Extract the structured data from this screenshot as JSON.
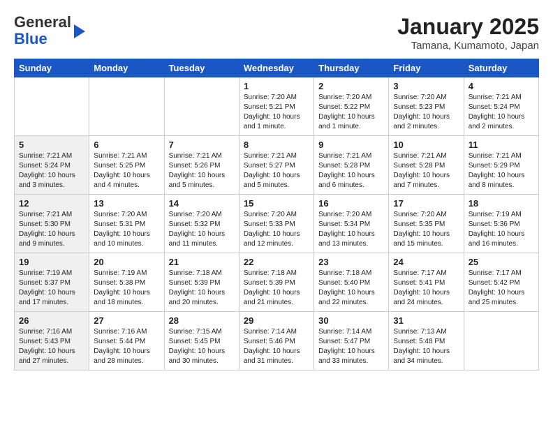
{
  "header": {
    "logo_line1": "General",
    "logo_line2": "Blue",
    "month": "January 2025",
    "location": "Tamana, Kumamoto, Japan"
  },
  "weekdays": [
    "Sunday",
    "Monday",
    "Tuesday",
    "Wednesday",
    "Thursday",
    "Friday",
    "Saturday"
  ],
  "weeks": [
    [
      {
        "day": "",
        "info": "",
        "shaded": true
      },
      {
        "day": "",
        "info": "",
        "shaded": true
      },
      {
        "day": "",
        "info": "",
        "shaded": true
      },
      {
        "day": "1",
        "info": "Sunrise: 7:20 AM\nSunset: 5:21 PM\nDaylight: 10 hours\nand 1 minute.",
        "shaded": false
      },
      {
        "day": "2",
        "info": "Sunrise: 7:20 AM\nSunset: 5:22 PM\nDaylight: 10 hours\nand 1 minute.",
        "shaded": false
      },
      {
        "day": "3",
        "info": "Sunrise: 7:20 AM\nSunset: 5:23 PM\nDaylight: 10 hours\nand 2 minutes.",
        "shaded": false
      },
      {
        "day": "4",
        "info": "Sunrise: 7:21 AM\nSunset: 5:24 PM\nDaylight: 10 hours\nand 2 minutes.",
        "shaded": false
      }
    ],
    [
      {
        "day": "5",
        "info": "Sunrise: 7:21 AM\nSunset: 5:24 PM\nDaylight: 10 hours\nand 3 minutes.",
        "shaded": true
      },
      {
        "day": "6",
        "info": "Sunrise: 7:21 AM\nSunset: 5:25 PM\nDaylight: 10 hours\nand 4 minutes.",
        "shaded": false
      },
      {
        "day": "7",
        "info": "Sunrise: 7:21 AM\nSunset: 5:26 PM\nDaylight: 10 hours\nand 5 minutes.",
        "shaded": false
      },
      {
        "day": "8",
        "info": "Sunrise: 7:21 AM\nSunset: 5:27 PM\nDaylight: 10 hours\nand 5 minutes.",
        "shaded": false
      },
      {
        "day": "9",
        "info": "Sunrise: 7:21 AM\nSunset: 5:28 PM\nDaylight: 10 hours\nand 6 minutes.",
        "shaded": false
      },
      {
        "day": "10",
        "info": "Sunrise: 7:21 AM\nSunset: 5:28 PM\nDaylight: 10 hours\nand 7 minutes.",
        "shaded": false
      },
      {
        "day": "11",
        "info": "Sunrise: 7:21 AM\nSunset: 5:29 PM\nDaylight: 10 hours\nand 8 minutes.",
        "shaded": false
      }
    ],
    [
      {
        "day": "12",
        "info": "Sunrise: 7:21 AM\nSunset: 5:30 PM\nDaylight: 10 hours\nand 9 minutes.",
        "shaded": true
      },
      {
        "day": "13",
        "info": "Sunrise: 7:20 AM\nSunset: 5:31 PM\nDaylight: 10 hours\nand 10 minutes.",
        "shaded": false
      },
      {
        "day": "14",
        "info": "Sunrise: 7:20 AM\nSunset: 5:32 PM\nDaylight: 10 hours\nand 11 minutes.",
        "shaded": false
      },
      {
        "day": "15",
        "info": "Sunrise: 7:20 AM\nSunset: 5:33 PM\nDaylight: 10 hours\nand 12 minutes.",
        "shaded": false
      },
      {
        "day": "16",
        "info": "Sunrise: 7:20 AM\nSunset: 5:34 PM\nDaylight: 10 hours\nand 13 minutes.",
        "shaded": false
      },
      {
        "day": "17",
        "info": "Sunrise: 7:20 AM\nSunset: 5:35 PM\nDaylight: 10 hours\nand 15 minutes.",
        "shaded": false
      },
      {
        "day": "18",
        "info": "Sunrise: 7:19 AM\nSunset: 5:36 PM\nDaylight: 10 hours\nand 16 minutes.",
        "shaded": false
      }
    ],
    [
      {
        "day": "19",
        "info": "Sunrise: 7:19 AM\nSunset: 5:37 PM\nDaylight: 10 hours\nand 17 minutes.",
        "shaded": true
      },
      {
        "day": "20",
        "info": "Sunrise: 7:19 AM\nSunset: 5:38 PM\nDaylight: 10 hours\nand 18 minutes.",
        "shaded": false
      },
      {
        "day": "21",
        "info": "Sunrise: 7:18 AM\nSunset: 5:39 PM\nDaylight: 10 hours\nand 20 minutes.",
        "shaded": false
      },
      {
        "day": "22",
        "info": "Sunrise: 7:18 AM\nSunset: 5:39 PM\nDaylight: 10 hours\nand 21 minutes.",
        "shaded": false
      },
      {
        "day": "23",
        "info": "Sunrise: 7:18 AM\nSunset: 5:40 PM\nDaylight: 10 hours\nand 22 minutes.",
        "shaded": false
      },
      {
        "day": "24",
        "info": "Sunrise: 7:17 AM\nSunset: 5:41 PM\nDaylight: 10 hours\nand 24 minutes.",
        "shaded": false
      },
      {
        "day": "25",
        "info": "Sunrise: 7:17 AM\nSunset: 5:42 PM\nDaylight: 10 hours\nand 25 minutes.",
        "shaded": false
      }
    ],
    [
      {
        "day": "26",
        "info": "Sunrise: 7:16 AM\nSunset: 5:43 PM\nDaylight: 10 hours\nand 27 minutes.",
        "shaded": true
      },
      {
        "day": "27",
        "info": "Sunrise: 7:16 AM\nSunset: 5:44 PM\nDaylight: 10 hours\nand 28 minutes.",
        "shaded": false
      },
      {
        "day": "28",
        "info": "Sunrise: 7:15 AM\nSunset: 5:45 PM\nDaylight: 10 hours\nand 30 minutes.",
        "shaded": false
      },
      {
        "day": "29",
        "info": "Sunrise: 7:14 AM\nSunset: 5:46 PM\nDaylight: 10 hours\nand 31 minutes.",
        "shaded": false
      },
      {
        "day": "30",
        "info": "Sunrise: 7:14 AM\nSunset: 5:47 PM\nDaylight: 10 hours\nand 33 minutes.",
        "shaded": false
      },
      {
        "day": "31",
        "info": "Sunrise: 7:13 AM\nSunset: 5:48 PM\nDaylight: 10 hours\nand 34 minutes.",
        "shaded": false
      },
      {
        "day": "",
        "info": "",
        "shaded": true
      }
    ]
  ]
}
